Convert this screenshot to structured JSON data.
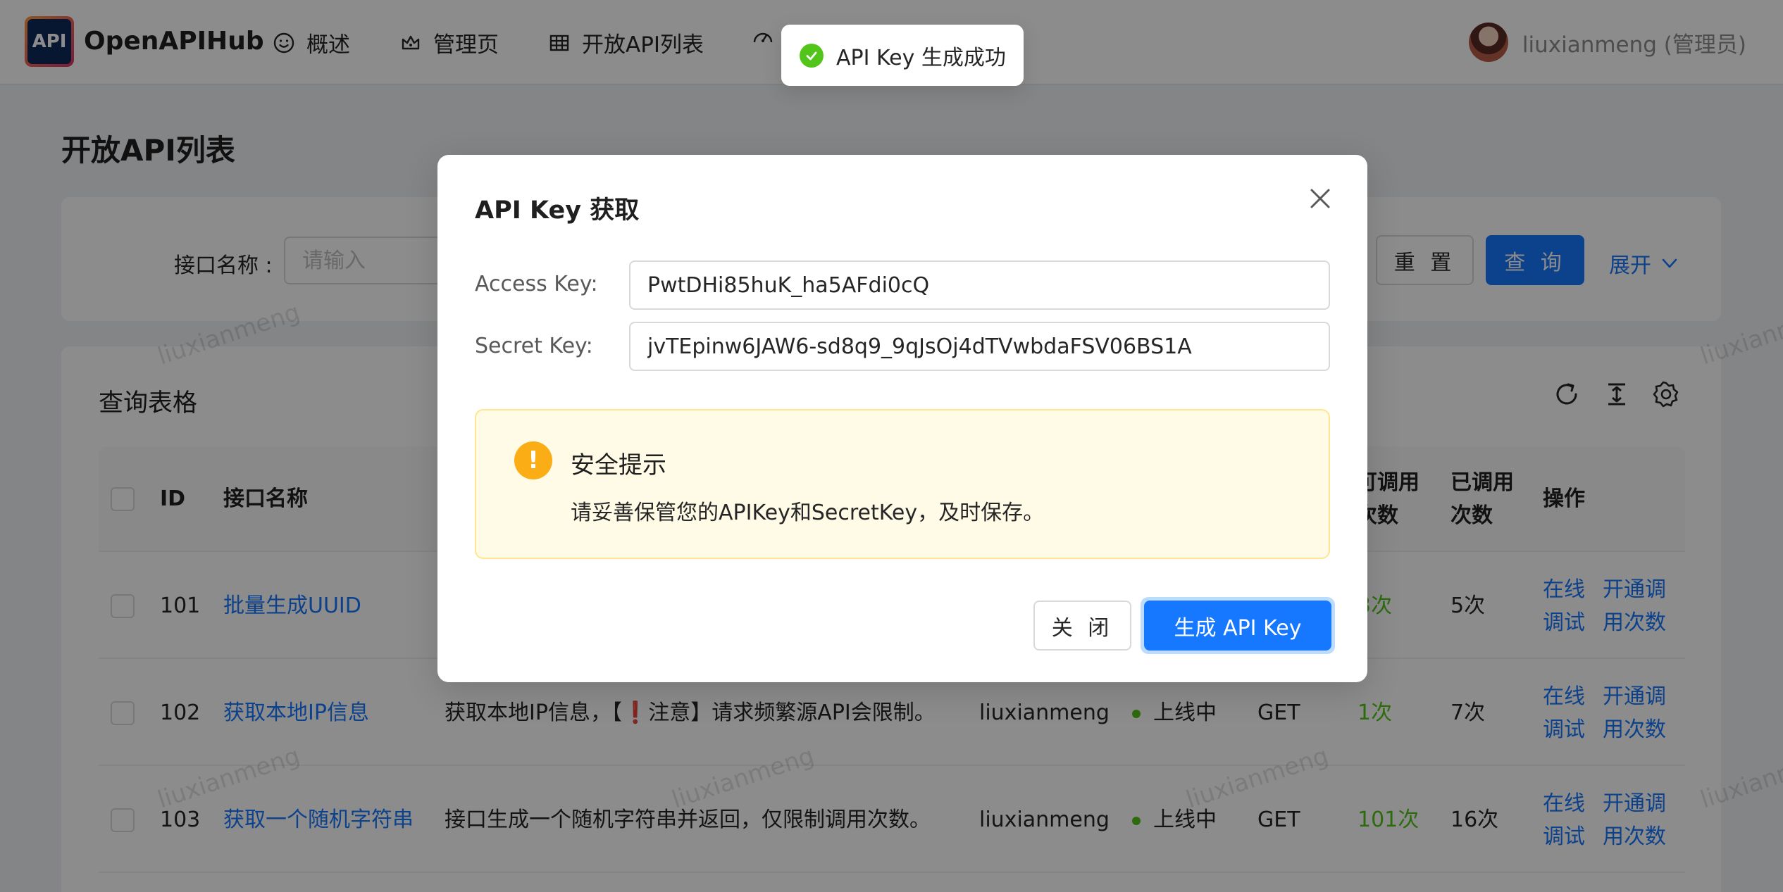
{
  "app": {
    "logo_text": "API",
    "name": "OpenAPIHub"
  },
  "nav": [
    {
      "label": "概述",
      "icon": "smile-icon"
    },
    {
      "label": "管理页",
      "icon": "crown-icon"
    },
    {
      "label": "开放API列表",
      "icon": "table-icon"
    },
    {
      "label": "",
      "icon": "dashboard-icon"
    }
  ],
  "user": {
    "name": "liuxianmeng (管理员)"
  },
  "page": {
    "title": "开放API列表"
  },
  "search": {
    "label": "接口名称 :",
    "placeholder": "请输入",
    "reset_label": "重 置",
    "query_label": "查 询",
    "expand_label": "展开"
  },
  "table": {
    "title": "查询表格",
    "headers": {
      "id": "ID",
      "name": "接口名称",
      "remaining_line1": "可调用",
      "remaining_line2": "次数",
      "used_line1": "已调用",
      "used_line2": "次数",
      "action": "操作"
    },
    "rows": [
      {
        "id": "101",
        "name": "批量生成UUID",
        "description": "",
        "owner": "",
        "status": "",
        "method": "",
        "remaining": "3次",
        "used": "5次",
        "action1_l1": "在线",
        "action1_l2": "调试",
        "action2_l1": "开通调",
        "action2_l2": "用次数"
      },
      {
        "id": "102",
        "name": "获取本地IP信息",
        "description": "获取本地IP信息，【❗注意】请求频繁源API会限制。",
        "owner": "liuxianmeng",
        "status": "上线中",
        "method": "GET",
        "remaining": "1次",
        "used": "7次",
        "action1_l1": "在线",
        "action1_l2": "调试",
        "action2_l1": "开通调",
        "action2_l2": "用次数"
      },
      {
        "id": "103",
        "name": "获取一个随机字符串",
        "description": "接口生成一个随机字符串并返回，仅限制调用次数。",
        "owner": "liuxianmeng",
        "status": "上线中",
        "method": "GET",
        "remaining": "101次",
        "used": "16次",
        "action1_l1": "在线",
        "action1_l2": "调试",
        "action2_l1": "开通调",
        "action2_l2": "用次数"
      }
    ]
  },
  "watermark": "liuxianmeng",
  "modal": {
    "title": "API Key 获取",
    "access_key_label": "Access Key:",
    "access_key_value": "PwtDHi85huK_ha5AFdi0cQ",
    "secret_key_label": "Secret Key:",
    "secret_key_value": "jvTEpinw6JAW6-sd8q9_9qJsOj4dTVwbdaFSV06BS1A",
    "alert_title": "安全提示",
    "alert_desc": "请妥善保管您的APIKey和SecretKey，及时保存。",
    "close_label": "关 闭",
    "generate_label": "生成 API Key"
  },
  "toast": {
    "message": "API Key 生成成功"
  },
  "colors": {
    "primary": "#1677ff",
    "success": "#52c41a",
    "warning": "#faad14"
  }
}
